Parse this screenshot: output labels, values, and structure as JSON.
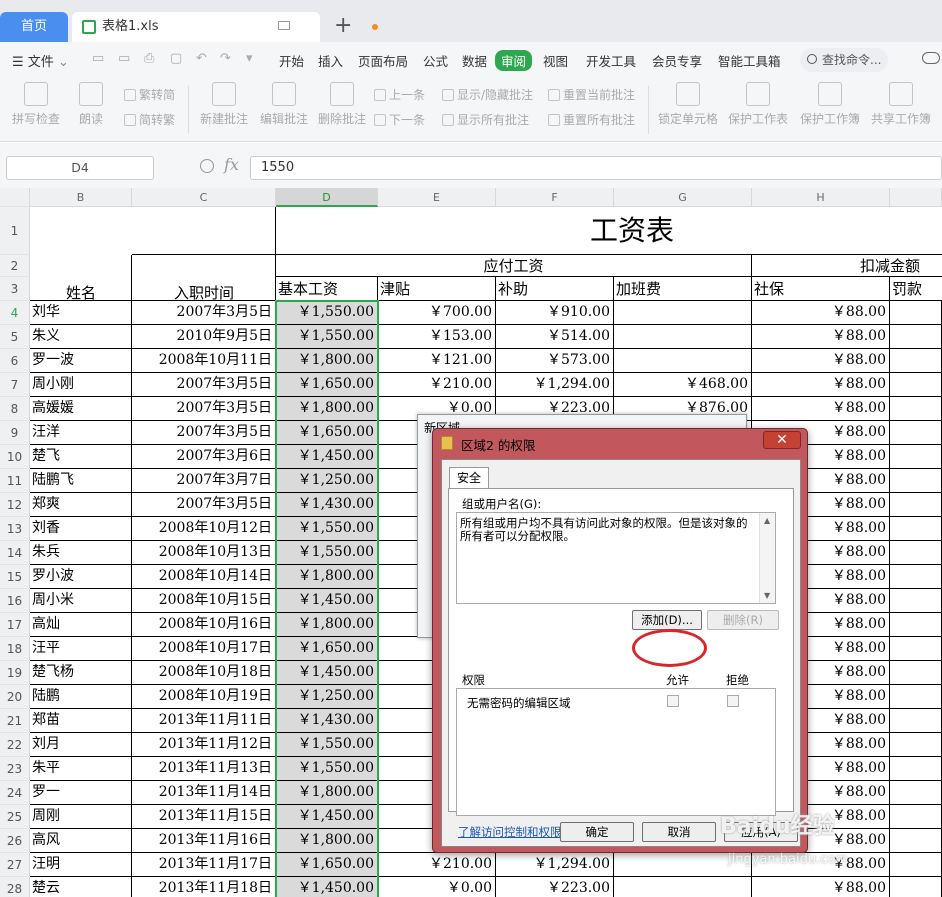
{
  "tabs": {
    "home": "首页",
    "file": "表格1.xls",
    "new": "+"
  },
  "menu": {
    "file": "文件",
    "items": [
      "开始",
      "插入",
      "页面布局",
      "公式",
      "数据",
      "审阅",
      "视图",
      "开发工具",
      "会员专享",
      "智能工具箱"
    ],
    "active": "审阅",
    "search": "查找命令..."
  },
  "ribbon": {
    "spell": "拼写检查",
    "read": "朗读",
    "trad": "繁转简",
    "simp": "简转繁",
    "new_note": "新建批注",
    "edit_note": "编辑批注",
    "del_note": "删除批注",
    "prev": "上一条",
    "next": "下一条",
    "showhide": "显示/隐藏批注",
    "showall": "显示所有批注",
    "reset_cur": "重置当前批注",
    "reset_all": "重置所有批注",
    "lock": "锁定单元格",
    "protect_sheet": "保护工作表",
    "protect_book": "保护工作簿",
    "share_book": "共享工作簿"
  },
  "formula": {
    "namebox": "D4",
    "fx": "fx",
    "value": "1550"
  },
  "columns": [
    "B",
    "C",
    "D",
    "E",
    "F",
    "G",
    "H"
  ],
  "sheet": {
    "title": "工资表",
    "group_payable": "应付工资",
    "group_deduct": "扣减金额",
    "headers": {
      "name": "姓名",
      "date": "入职时间",
      "base": "基本工资",
      "allowance": "津贴",
      "subsidy": "补助",
      "overtime": "加班费",
      "social": "社保",
      "fine": "罚款"
    },
    "row_numbers": [
      "1",
      "2",
      "3",
      "4",
      "5",
      "6",
      "7",
      "8",
      "9",
      "10",
      "11",
      "12",
      "13",
      "14",
      "15",
      "16",
      "17",
      "18",
      "19",
      "20",
      "21",
      "22",
      "23",
      "24",
      "25",
      "26",
      "27",
      "28"
    ],
    "rows": [
      {
        "name": "刘华",
        "date": "2007年3月5日",
        "base": "￥1,550.00",
        "allowance": "￥700.00",
        "subsidy": "￥910.00",
        "overtime": "",
        "social": "￥88.00"
      },
      {
        "name": "朱义",
        "date": "2010年9月5日",
        "base": "￥1,550.00",
        "allowance": "￥153.00",
        "subsidy": "￥514.00",
        "overtime": "",
        "social": "￥88.00"
      },
      {
        "name": "罗一波",
        "date": "2008年10月11日",
        "base": "￥1,800.00",
        "allowance": "￥121.00",
        "subsidy": "￥573.00",
        "overtime": "",
        "social": "￥88.00"
      },
      {
        "name": "周小刚",
        "date": "2007年3月5日",
        "base": "￥1,650.00",
        "allowance": "￥210.00",
        "subsidy": "￥1,294.00",
        "overtime": "￥468.00",
        "social": "￥88.00"
      },
      {
        "name": "高媛媛",
        "date": "2007年3月5日",
        "base": "￥1,800.00",
        "allowance": "￥0.00",
        "subsidy": "￥223.00",
        "overtime": "￥876.00",
        "social": "￥88.00"
      },
      {
        "name": "汪洋",
        "date": "2007年3月5日",
        "base": "￥1,650.00",
        "allowance": "",
        "subsidy": "",
        "overtime": "",
        "social": "￥88.00"
      },
      {
        "name": "楚飞",
        "date": "2007年3月6日",
        "base": "￥1,450.00",
        "allowance": "",
        "subsidy": "",
        "overtime": "",
        "social": "￥88.00"
      },
      {
        "name": "陆鹏飞",
        "date": "2007年3月7日",
        "base": "￥1,250.00",
        "allowance": "",
        "subsidy": "",
        "overtime": "",
        "social": "￥88.00"
      },
      {
        "name": "郑爽",
        "date": "2007年3月5日",
        "base": "￥1,430.00",
        "allowance": "",
        "subsidy": "",
        "overtime": "",
        "social": "￥88.00"
      },
      {
        "name": "刘香",
        "date": "2008年10月12日",
        "base": "￥1,550.00",
        "allowance": "",
        "subsidy": "",
        "overtime": "",
        "social": "￥88.00"
      },
      {
        "name": "朱兵",
        "date": "2008年10月13日",
        "base": "￥1,550.00",
        "allowance": "",
        "subsidy": "",
        "overtime": "",
        "social": "￥88.00"
      },
      {
        "name": "罗小波",
        "date": "2008年10月14日",
        "base": "￥1,800.00",
        "allowance": "",
        "subsidy": "",
        "overtime": "",
        "social": "￥88.00"
      },
      {
        "name": "周小米",
        "date": "2008年10月15日",
        "base": "￥1,450.00",
        "allowance": "",
        "subsidy": "",
        "overtime": "",
        "social": "￥88.00"
      },
      {
        "name": "高灿",
        "date": "2008年10月16日",
        "base": "￥1,800.00",
        "allowance": "",
        "subsidy": "",
        "overtime": "",
        "social": "￥88.00"
      },
      {
        "name": "汪平",
        "date": "2008年10月17日",
        "base": "￥1,650.00",
        "allowance": "",
        "subsidy": "",
        "overtime": "",
        "social": "￥88.00"
      },
      {
        "name": "楚飞杨",
        "date": "2008年10月18日",
        "base": "￥1,450.00",
        "allowance": "",
        "subsidy": "",
        "overtime": "",
        "social": "￥88.00"
      },
      {
        "name": "陆鹏",
        "date": "2008年10月19日",
        "base": "￥1,250.00",
        "allowance": "",
        "subsidy": "",
        "overtime": "",
        "social": "￥88.00"
      },
      {
        "name": "郑苗",
        "date": "2013年11月11日",
        "base": "￥1,430.00",
        "allowance": "",
        "subsidy": "",
        "overtime": "",
        "social": "￥88.00"
      },
      {
        "name": "刘月",
        "date": "2013年11月12日",
        "base": "￥1,550.00",
        "allowance": "",
        "subsidy": "",
        "overtime": "",
        "social": "￥88.00"
      },
      {
        "name": "朱平",
        "date": "2013年11月13日",
        "base": "￥1,550.00",
        "allowance": "",
        "subsidy": "",
        "overtime": "",
        "social": "￥88.00"
      },
      {
        "name": "罗一",
        "date": "2013年11月14日",
        "base": "￥1,800.00",
        "allowance": "",
        "subsidy": "",
        "overtime": "",
        "social": "￥88.00"
      },
      {
        "name": "周刚",
        "date": "2013年11月15日",
        "base": "￥1,450.00",
        "allowance": "",
        "subsidy": "",
        "overtime": "",
        "social": "￥88.00"
      },
      {
        "name": "高风",
        "date": "2013年11月16日",
        "base": "￥1,800.00",
        "allowance": "",
        "subsidy": "",
        "overtime": "",
        "social": "￥88.00"
      },
      {
        "name": "汪明",
        "date": "2013年11月17日",
        "base": "￥1,650.00",
        "allowance": "￥210.00",
        "subsidy": "￥1,294.00",
        "overtime": "",
        "social": "￥88.00"
      },
      {
        "name": "楚云",
        "date": "2013年11月18日",
        "base": "￥1,450.00",
        "allowance": "￥0.00",
        "subsidy": "￥223.00",
        "overtime": "",
        "social": "￥88.00"
      }
    ]
  },
  "back_dialog": {
    "title": "新区域"
  },
  "dialog": {
    "title": "区域2 的权限",
    "close": "✕",
    "tab": "安全",
    "group_label": "组或用户名(G):",
    "group_text": "所有组或用户均不具有访问此对象的权限。但是该对象的所有者可以分配权限。",
    "add": "添加(D)...",
    "remove": "删除(R)",
    "perm_label": "权限",
    "allow": "允许",
    "deny": "拒绝",
    "perm_item": "无需密码的编辑区域",
    "link": "了解访问控制和权限",
    "ok": "确定",
    "cancel": "取消",
    "apply": "应用(A)"
  },
  "watermark": {
    "brand": "Baidu经验",
    "url": "jingyan.baidu.com"
  }
}
